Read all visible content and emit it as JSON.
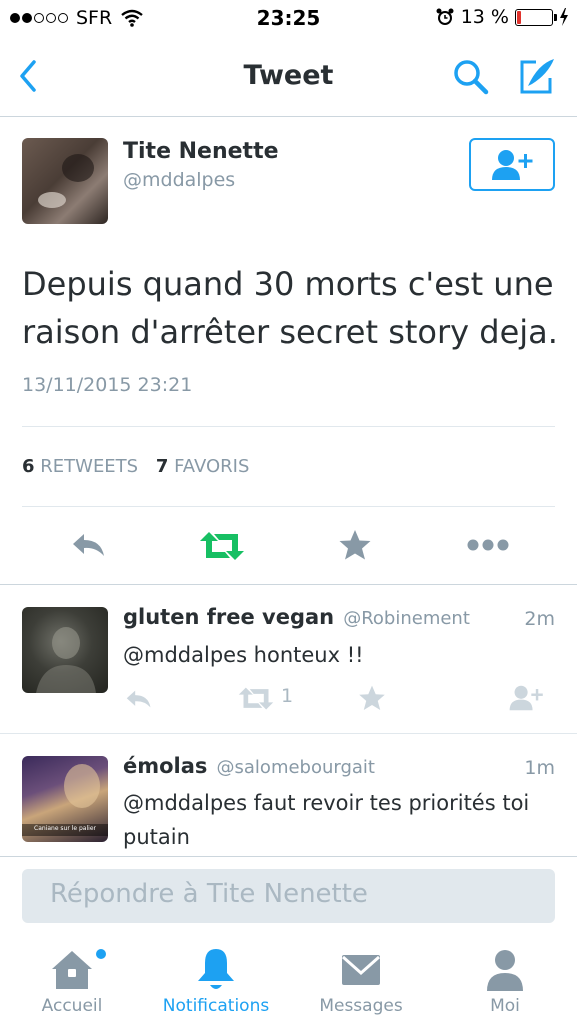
{
  "status_bar": {
    "carrier": "SFR",
    "time": "23:25",
    "battery": "13 %",
    "battery_level": 0.13,
    "signal_bars_filled": 2,
    "signal_bars_total": 5
  },
  "nav": {
    "title": "Tweet",
    "back_icon": "chevron-left-icon",
    "search_icon": "search-icon",
    "compose_icon": "compose-icon"
  },
  "tweet": {
    "author_name": "Tite Nenette",
    "author_handle": "@mddalpes",
    "text": "Depuis quand 30 morts c'est une raison d'arrêter secret story deja.",
    "timestamp": "13/11/2015 23:21",
    "retweets_count": "6",
    "retweets_label": "RETWEETS",
    "favorites_count": "7",
    "favorites_label": "FAVORIS"
  },
  "replies": [
    {
      "name": "gluten free vegan",
      "handle": "@Robinement",
      "time": "2m",
      "text": "@mddalpes honteux !!",
      "retweet_count": "1"
    },
    {
      "name": "émolas",
      "handle": "@salomebourgait",
      "time": "1m",
      "text": "@mddalpes faut revoir tes priorités toi putain",
      "avatar_caption": "Caniane sur le palier"
    }
  ],
  "composer": {
    "placeholder": "Répondre à Tite Nenette"
  },
  "tabs": [
    {
      "label": "Accueil",
      "icon": "home-icon",
      "active": false,
      "badge": true
    },
    {
      "label": "Notifications",
      "icon": "bell-icon",
      "active": true
    },
    {
      "label": "Messages",
      "icon": "envelope-icon",
      "active": false
    },
    {
      "label": "Moi",
      "icon": "person-icon",
      "active": false
    }
  ],
  "colors": {
    "accent": "#1da1f2",
    "retweet_green": "#17bf63",
    "gray_icon": "#8899a6",
    "battery_low": "#e0332d"
  }
}
